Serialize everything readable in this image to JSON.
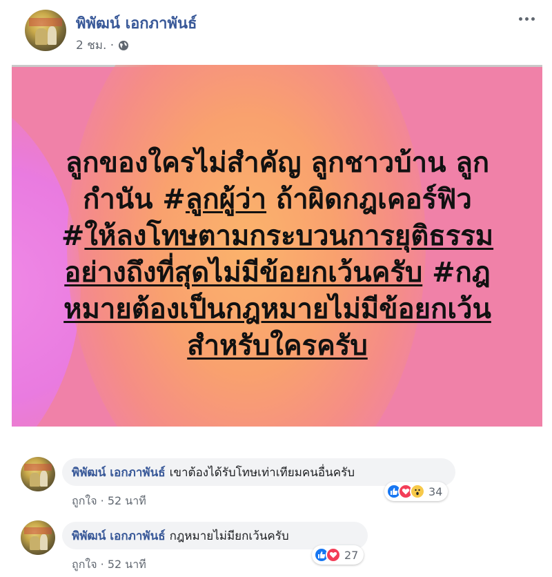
{
  "post": {
    "author": "พิพัฒน์ เอกภาพันธ์",
    "time": "2 ชม. ·",
    "image_text": {
      "line1": "ลูกของใครไม่สำคัญ ลูกชาวบ้าน ลูก",
      "line2a": "กำนัน #",
      "line2b": "ลูกผู้ว่า",
      "line2c": " ถ้าผิดกฎเคอร์ฟิว",
      "line3a": "#",
      "line3b": "ให้ลงโทษตามกระบวนการยุติธรรม",
      "line4a": "อย่างถึงที่สุดไม่มีข้อยกเว้นครับ",
      "line4b": " #กฎ",
      "line5": "หมายต้องเป็นกฎหมายไม่มีข้อยกเว้น",
      "line6": "สำหรับใครครับ"
    },
    "colors": {
      "background": "#f081a8",
      "glow_orange": "#fbb36c",
      "glow_violet": "#f08ae6",
      "link": "#385898"
    }
  },
  "comments": [
    {
      "author": "พิพัฒน์ เอกภาพันธ์",
      "text": "เขาต้องได้รับโทษเท่าเทียมคนอื่นครับ",
      "like_label": "ถูกใจ",
      "time": "· 52 นาที",
      "reaction_count": "34",
      "reactions": [
        "like-icon",
        "love-icon",
        "wow-icon"
      ]
    },
    {
      "author": "พิพัฒน์ เอกภาพันธ์",
      "text": "กฎหมายไม่มียกเว้นครับ",
      "like_label": "ถูกใจ",
      "time": "· 52 นาที",
      "reaction_count": "27",
      "reactions": [
        "like-icon",
        "love-icon"
      ]
    }
  ],
  "icons": {
    "globe": "globe-icon",
    "more": "more-options-icon"
  }
}
